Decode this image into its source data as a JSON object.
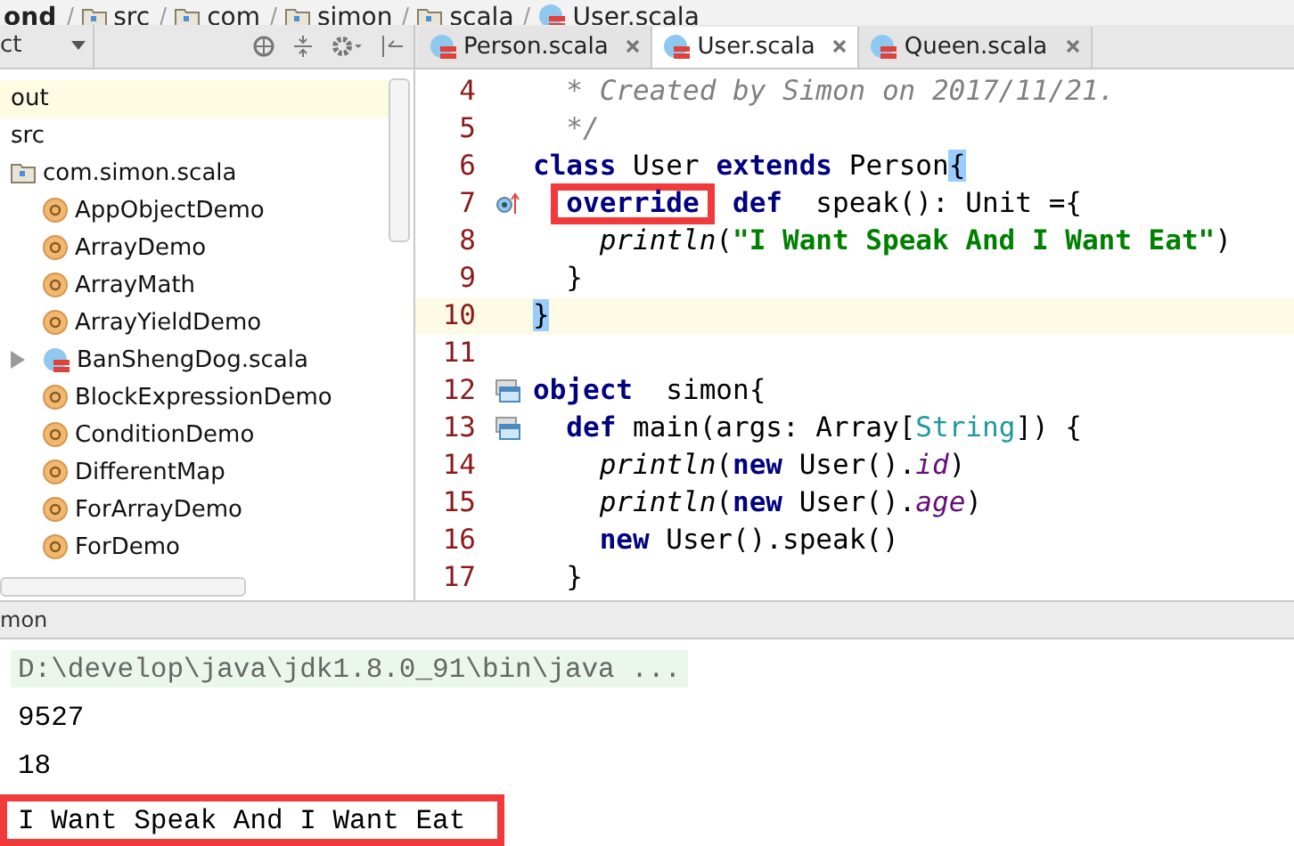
{
  "breadcrumb": [
    {
      "label": "ond",
      "kind": "project"
    },
    {
      "label": "src",
      "kind": "folder"
    },
    {
      "label": "com",
      "kind": "package"
    },
    {
      "label": "simon",
      "kind": "package"
    },
    {
      "label": "scala",
      "kind": "package"
    },
    {
      "label": "User.scala",
      "kind": "file"
    }
  ],
  "project_panel": {
    "view_selector": "ct",
    "items": [
      {
        "label": "out",
        "kind": "folder",
        "selected": true,
        "expandable": false
      },
      {
        "label": "src",
        "kind": "folder",
        "selected": false,
        "expandable": false
      },
      {
        "label": "com.simon.scala",
        "kind": "package",
        "selected": false,
        "expandable": false,
        "children": [
          {
            "label": "AppObjectDemo",
            "kind": "object",
            "selected": false,
            "expandable": false
          },
          {
            "label": "ArrayDemo",
            "kind": "object",
            "selected": false,
            "expandable": false
          },
          {
            "label": "ArrayMath",
            "kind": "object",
            "selected": false,
            "expandable": false
          },
          {
            "label": "ArrayYieldDemo",
            "kind": "object",
            "selected": false,
            "expandable": false
          },
          {
            "label": "BanShengDog.scala",
            "kind": "file",
            "selected": false,
            "expandable": true
          },
          {
            "label": "BlockExpressionDemo",
            "kind": "object",
            "selected": false,
            "expandable": false
          },
          {
            "label": "ConditionDemo",
            "kind": "object",
            "selected": false,
            "expandable": false
          },
          {
            "label": "DifferentMap",
            "kind": "object",
            "selected": false,
            "expandable": false
          },
          {
            "label": "ForArrayDemo",
            "kind": "object",
            "selected": false,
            "expandable": false
          },
          {
            "label": "ForDemo",
            "kind": "object",
            "selected": false,
            "expandable": false
          }
        ]
      }
    ]
  },
  "editor": {
    "tabs": [
      {
        "label": "Person.scala",
        "selected": false
      },
      {
        "label": "User.scala",
        "selected": true
      },
      {
        "label": "Queen.scala",
        "selected": false
      }
    ],
    "lines": [
      {
        "number": "4",
        "current": false,
        "override_marker": false,
        "run_marker": false,
        "segments": [
          {
            "text": "  * Created by Simon on 2017/11/21.",
            "kind": "comment"
          }
        ]
      },
      {
        "number": "5",
        "current": false,
        "override_marker": false,
        "run_marker": false,
        "segments": [
          {
            "text": "  */",
            "kind": "comment"
          }
        ]
      },
      {
        "number": "6",
        "current": false,
        "override_marker": false,
        "run_marker": false,
        "segments": [
          {
            "text": "class",
            "kind": "keyword"
          },
          {
            "text": " User",
            "kind": "plain"
          },
          {
            "text": " extends",
            "kind": "keyword"
          },
          {
            "text": " Person",
            "kind": "plain"
          },
          {
            "text": "{",
            "kind": "brace"
          }
        ]
      },
      {
        "number": "7",
        "current": false,
        "override_marker": true,
        "run_marker": false,
        "segments": [
          {
            "text": "  override",
            "kind": "keyword",
            "boxed": true
          },
          {
            "text": "  def",
            "kind": "keyword"
          },
          {
            "text": "  speak(): Unit ={",
            "kind": "plain"
          }
        ]
      },
      {
        "number": "8",
        "current": false,
        "override_marker": false,
        "run_marker": false,
        "segments": [
          {
            "text": "    println",
            "kind": "call"
          },
          {
            "text": "(",
            "kind": "plain"
          },
          {
            "text": "\"I Want Speak And I Want Eat\"",
            "kind": "string"
          },
          {
            "text": ")",
            "kind": "plain"
          }
        ]
      },
      {
        "number": "9",
        "current": false,
        "override_marker": false,
        "run_marker": false,
        "segments": [
          {
            "text": "  }",
            "kind": "plain"
          }
        ]
      },
      {
        "number": "10",
        "current": true,
        "override_marker": false,
        "run_marker": false,
        "segments": [
          {
            "text": "}",
            "kind": "brace"
          }
        ]
      },
      {
        "number": "11",
        "current": false,
        "override_marker": false,
        "run_marker": false
      },
      {
        "number": "12",
        "current": false,
        "override_marker": false,
        "run_marker": true,
        "segments": [
          {
            "text": "object",
            "kind": "keyword"
          },
          {
            "text": "  simon{",
            "kind": "plain"
          }
        ]
      },
      {
        "number": "13",
        "current": false,
        "override_marker": false,
        "run_marker": true,
        "segments": [
          {
            "text": "  def",
            "kind": "keyword"
          },
          {
            "text": " main(args: Array[",
            "kind": "plain"
          },
          {
            "text": "String",
            "kind": "type"
          },
          {
            "text": "]) {",
            "kind": "plain"
          }
        ]
      },
      {
        "number": "14",
        "current": false,
        "override_marker": false,
        "run_marker": false,
        "segments": [
          {
            "text": "    println",
            "kind": "call"
          },
          {
            "text": "(",
            "kind": "plain"
          },
          {
            "text": "new",
            "kind": "keyword"
          },
          {
            "text": " User().",
            "kind": "plain"
          },
          {
            "text": "id",
            "kind": "field"
          },
          {
            "text": ")",
            "kind": "plain"
          }
        ]
      },
      {
        "number": "15",
        "current": false,
        "override_marker": false,
        "run_marker": false,
        "segments": [
          {
            "text": "    println",
            "kind": "call"
          },
          {
            "text": "(",
            "kind": "plain"
          },
          {
            "text": "new",
            "kind": "keyword"
          },
          {
            "text": " User().",
            "kind": "plain"
          },
          {
            "text": "age",
            "kind": "field"
          },
          {
            "text": ")",
            "kind": "plain"
          }
        ]
      },
      {
        "number": "16",
        "current": false,
        "override_marker": false,
        "run_marker": false,
        "segments": [
          {
            "text": "    new",
            "kind": "keyword"
          },
          {
            "text": " User().speak()",
            "kind": "plain"
          }
        ]
      },
      {
        "number": "17",
        "current": false,
        "override_marker": false,
        "run_marker": false,
        "segments": [
          {
            "text": "  }",
            "kind": "plain"
          }
        ]
      }
    ]
  },
  "run_panel": {
    "title": "mon",
    "output": [
      {
        "text": "D:\\develop\\java\\jdk1.8.0_91\\bin\\java ...",
        "kind": "command",
        "boxed": false
      },
      {
        "text": "9527",
        "kind": "stdout",
        "boxed": false
      },
      {
        "text": "18",
        "kind": "stdout",
        "boxed": false
      },
      {
        "text": "I Want Speak And I Want Eat",
        "kind": "stdout",
        "boxed": true
      }
    ]
  }
}
